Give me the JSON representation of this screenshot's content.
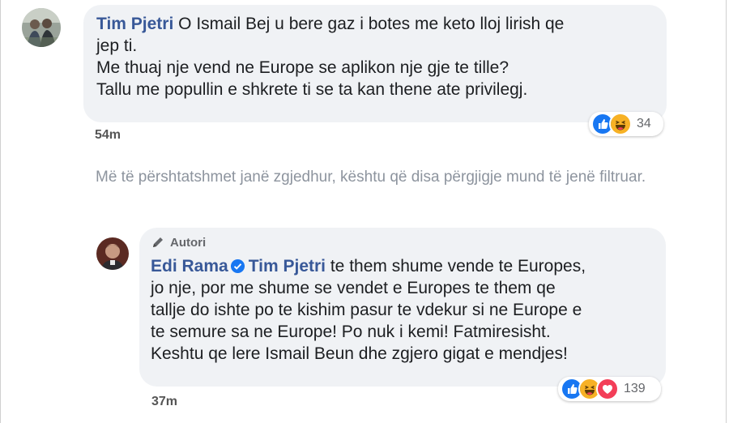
{
  "comment1": {
    "author": "Tim Pjetri",
    "text_first": " O Ismail Bej u bere gaz i botes me keto lloj lirish qe",
    "lines": [
      "jep ti.",
      "Me thuaj nje vend ne Europe se aplikon nje gje te tille?",
      "Tallu me popullin e shkrete ti se ta kan thene ate privilegj."
    ],
    "time": "54m",
    "reaction_count": "34",
    "reaction_icons": [
      "like-icon",
      "haha-icon"
    ]
  },
  "filter_note": "Më të përshtatshmet janë zgjedhur, kështu që disa përgjigje mund të jenë filtruar.",
  "comment2": {
    "badge": "Autori",
    "author": "Edi Rama",
    "mention": "Tim Pjetri",
    "text_first": " te them shume vende te Europes,",
    "lines": [
      "jo nje, por me shume se vendet e Europes te them qe",
      "tallje do ishte po te kishim pasur te vdekur si ne Europe e",
      "te semure sa ne Europe! Po nuk i kemi! Fatmiresisht.",
      "Keshtu qe lere Ismail Beun dhe zgjero gigat e mendjes!"
    ],
    "time": "37m",
    "reaction_count": "139",
    "reaction_icons": [
      "like-icon",
      "haha-icon",
      "love-icon"
    ]
  },
  "colors": {
    "author": "#385898",
    "bubble": "#f0f2f5",
    "like": "#1877f2",
    "love": "#f33e58",
    "haha": "#f7b125"
  }
}
